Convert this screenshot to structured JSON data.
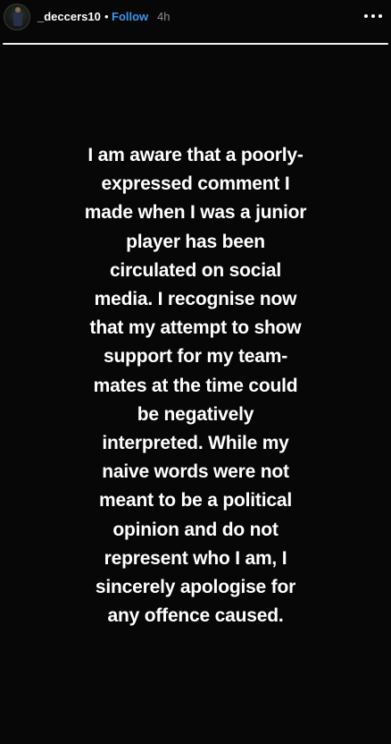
{
  "header": {
    "username": "_deccers10",
    "separator": "•",
    "follow_label": "Follow",
    "time": "4h"
  },
  "progress": {
    "fraction": 1.0
  },
  "story": {
    "text": "I am aware that a poorly-\nexpressed comment I\nmade when I was a junior\nplayer has been\ncirculated on social\nmedia. I recognise now\nthat my attempt to show\nsupport for my team-\nmates at the time could\nbe negatively\ninterpreted. While my\nnaive words were not\nmeant to be a political\nopinion and do not\nrepresent who I am, I\nsincerely apologise for\nany offence caused."
  },
  "colors": {
    "background": "#070707",
    "follow": "#3897f0",
    "time": "#8e8e8e",
    "text": "#ffffff"
  },
  "icons": {
    "avatar": "profile-avatar",
    "more": "more-options-icon"
  }
}
